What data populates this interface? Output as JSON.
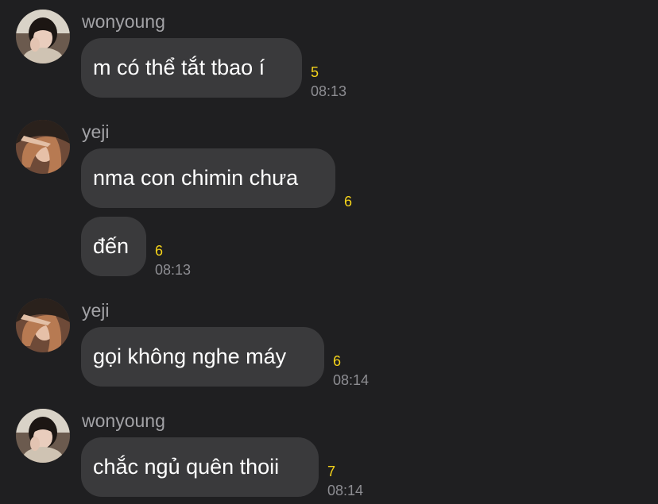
{
  "colors": {
    "background": "#1f1f21",
    "bubble": "#3a3a3c",
    "message_text": "#ffffff",
    "sender_name": "#a2a2a6",
    "timestamp": "#8d8d92",
    "unread_count": "#f5d31a"
  },
  "messages": [
    {
      "sender": "wonyoung",
      "text": "m có thể tắt tbao í",
      "unread": "5",
      "time": "08:13"
    },
    {
      "sender": "yeji",
      "text": "nma con chimin chưa",
      "unread": "6"
    },
    {
      "text": "đến",
      "unread": "6",
      "time": "08:13"
    },
    {
      "sender": "yeji",
      "text": "gọi không nghe máy",
      "unread": "6",
      "time": "08:14"
    },
    {
      "sender": "wonyoung",
      "text": "chắc ngủ quên thoii",
      "unread": "7",
      "time": "08:14"
    }
  ]
}
